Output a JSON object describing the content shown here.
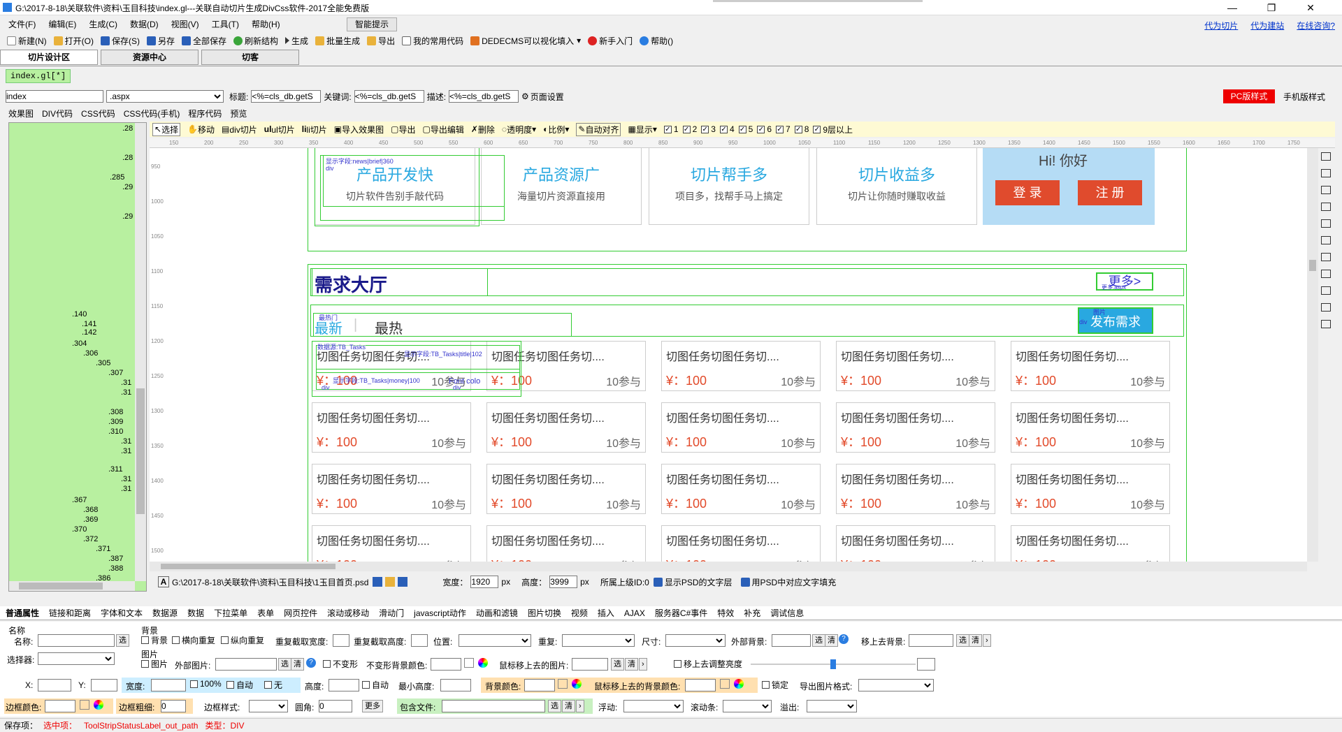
{
  "window": {
    "title": "G:\\2017-8-18\\关联软件\\资料\\玉目科技\\index.gl---关联自动切片生成DivCss软件-2017全能免费版"
  },
  "menu": [
    "文件(F)",
    "编辑(E)",
    "生成(C)",
    "数据(D)",
    "视图(V)",
    "工具(T)",
    "帮助(H)"
  ],
  "smart_hint": "智能提示",
  "top_links": [
    "代为切片",
    "代为建站",
    "在线咨询?"
  ],
  "toolbar": [
    "新建(N)",
    "打开(O)",
    "保存(S)",
    "另存",
    "全部保存",
    "刷新结构",
    "生成",
    "批量生成",
    "导出",
    "我的常用代码",
    "DEDECMS可以视化填入",
    "新手入门",
    "帮助()"
  ],
  "main_tabs": [
    "切片设计区",
    "资源中心",
    "切客"
  ],
  "doc_tab": "index.gl[*]",
  "file_bar": {
    "name": "index",
    "ext": ".aspx",
    "title_label": "标题:",
    "title_val": "<%=cls_db.getS",
    "kw_label": "关键词:",
    "kw_val": "<%=cls_db.getS",
    "desc_label": "描述:",
    "desc_val": "<%=cls_db.getS",
    "page_set": "页面设置",
    "pc_btn": "PC版样式",
    "mobile_btn": "手机版样式"
  },
  "sub_tabs": [
    "效果图",
    "DIV代码",
    "CSS代码",
    "CSS代码(手机)",
    "程序代码",
    "预览"
  ],
  "tree_nodes": [
    ".28",
    ".28",
    ".285",
    ".29",
    ".29",
    ".140",
    ".141",
    ".142",
    ".304",
    ".306",
    ".305",
    ".307",
    ".31",
    ".31",
    ".308",
    ".309",
    ".310",
    ".31",
    ".31",
    ".311",
    ".31",
    ".31",
    ".367",
    ".368",
    ".369",
    ".370",
    ".372",
    ".371",
    ".387",
    ".388",
    ".386"
  ],
  "canvas_tools": [
    "选择",
    "移动",
    "div切片",
    "ul切片",
    "li切片",
    "导入效果图",
    "导出",
    "导出编辑",
    "删除",
    "透明度",
    "比例",
    "自动对齐",
    "显示"
  ],
  "layers": [
    "1",
    "2",
    "3",
    "4",
    "5",
    "6",
    "7",
    "8",
    "9层以上"
  ],
  "ruler": [
    "150",
    "200",
    "250",
    "300",
    "350",
    "400",
    "450",
    "500",
    "550",
    "600",
    "650",
    "700",
    "750",
    "800",
    "850",
    "900",
    "950",
    "1000",
    "1050",
    "1100",
    "1150",
    "1200",
    "1250",
    "1300",
    "1350",
    "1400",
    "1450",
    "1500",
    "1550",
    "1600",
    "1650",
    "1700",
    "1750"
  ],
  "vruler": [
    "950",
    "1000",
    "1050",
    "1100",
    "1150",
    "1200",
    "1250",
    "1300",
    "1350",
    "1400",
    "1450",
    "1500"
  ],
  "features": [
    {
      "h": "产品开发快",
      "s": "切片软件告别手敲代码"
    },
    {
      "h": "产品资源广",
      "s": "海量切片资源直接用"
    },
    {
      "h": "切片帮手多",
      "s": "项目多，找帮手马上搞定"
    },
    {
      "h": "切片收益多",
      "s": "切片让你随时赚取收益"
    }
  ],
  "hello": "Hi! 你好",
  "login": "登 录",
  "register": "注 册",
  "demand_title": "需求大厅",
  "more": "更多>",
  "tab_new": "最新",
  "tab_hot": "最热",
  "publish": "发布需求",
  "task": {
    "title": "切图任务切图任务切....",
    "price": "¥：100",
    "join": "10参与"
  },
  "overlay_labels": [
    "显示字段:news|brief|360",
    "div",
    "div",
    "div",
    "div",
    "最热门",
    "数据源:TB_Tasks",
    "显示字段:TB_Tasks|money|100",
    "显示字段:TB_Tasks|title|102",
    "Font colo",
    "图片",
    "div",
    "更多.aspx"
  ],
  "bottom_bar": {
    "path": "G:\\2017-8-18\\关联软件\\资料\\玉目科技\\1玉目首页.psd",
    "w_label": "宽度：",
    "w": "1920",
    "unit": "px",
    "h_label": "高度：",
    "h": "3999",
    "parent": "所属上级ID:0",
    "psd_text": "显示PSD的文字层",
    "fill": "用PSD中对应文字填充"
  },
  "prop_tabs": [
    "普通属性",
    "链接和距离",
    "字体和文本",
    "数据源",
    "数据",
    "下拉菜单",
    "表单",
    "网页控件",
    "滚动或移动",
    "滑动门",
    "javascript动作",
    "动画和滤镜",
    "图片切换",
    "视频",
    "插入",
    "AJAX",
    "服务器C#事件",
    "特效",
    "补充",
    "调试信息"
  ],
  "props": {
    "name_group": "名称",
    "name": "名称:",
    "selector": "选择器:",
    "bg_group": "背景",
    "bg": "背景",
    "repeat_x": "横向重复",
    "repeat_y": "纵向重复",
    "rep_w": "重复截取宽度:",
    "rep_h": "重复截取高度:",
    "pos": "位置:",
    "repeat": "重复:",
    "size": "尺寸:",
    "ext_bg": "外部背景:",
    "hover_bg": "移上去背景:",
    "img_group": "图片",
    "img": "图片",
    "ext_img": "外部图片:",
    "nodeform": "不变形",
    "nodeform_bg": "不变形背景颜色:",
    "hover_img": "鼠标移上去的图片:",
    "hover_bright": "移上去调整亮度",
    "x": "X:",
    "y": "Y:",
    "width": "宽度:",
    "w100": "100%",
    "auto": "自动",
    "none": "无",
    "height": "高度:",
    "auto2": "自动",
    "min_h": "最小高度:",
    "bg_color": "背景颜色:",
    "hover_bg_color": "鼠标移上去的背景颜色:",
    "lock": "锁定",
    "export_fmt": "导出图片格式:",
    "border_color": "边框颜色:",
    "border_w": "边框粗细:",
    "border_w_val": "0",
    "border_style": "边框样式:",
    "radius": "圆角:",
    "radius_val": "0",
    "more": "更多",
    "include": "包含文件:",
    "float": "浮动:",
    "scroll": "滚动条:",
    "overflow": "溢出:",
    "sel": "选",
    "clr": "清"
  },
  "status": {
    "save": "保存项：",
    "sel": "选中项：",
    "label": "ToolStripStatusLabel_out_path",
    "type": "类型：DIV"
  }
}
